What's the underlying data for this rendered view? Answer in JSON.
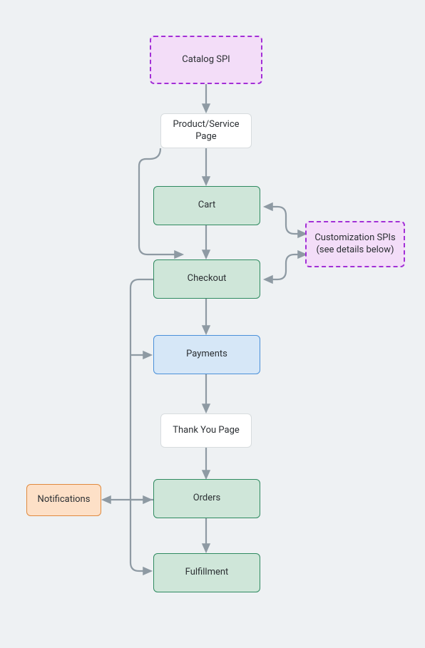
{
  "nodes": {
    "catalog_spi": {
      "label": "Catalog SPI"
    },
    "product_page": {
      "label": "Product/Service Page"
    },
    "cart": {
      "label": "Cart"
    },
    "customization_spis": {
      "label": "Customization SPIs (see details below)"
    },
    "checkout": {
      "label": "Checkout"
    },
    "payments": {
      "label": "Payments"
    },
    "thank_you": {
      "label": "Thank You Page"
    },
    "orders": {
      "label": "Orders"
    },
    "notifications": {
      "label": "Notifications"
    },
    "fulfillment": {
      "label": "Fulfillment"
    }
  },
  "edges": [
    {
      "from": "catalog_spi",
      "to": "product_page",
      "bidirectional": false
    },
    {
      "from": "product_page",
      "to": "cart",
      "bidirectional": false
    },
    {
      "from": "product_page",
      "to": "checkout",
      "bidirectional": false,
      "routing": "left-bypass"
    },
    {
      "from": "cart",
      "to": "checkout",
      "bidirectional": false
    },
    {
      "from": "customization_spis",
      "to": "cart",
      "bidirectional": true
    },
    {
      "from": "customization_spis",
      "to": "checkout",
      "bidirectional": true
    },
    {
      "from": "checkout",
      "to": "payments",
      "bidirectional": false
    },
    {
      "from": "payments",
      "to": "thank_you",
      "bidirectional": false
    },
    {
      "from": "thank_you",
      "to": "orders",
      "bidirectional": false
    },
    {
      "from": "orders",
      "to": "fulfillment",
      "bidirectional": false
    },
    {
      "from": "orders",
      "to": "notifications",
      "bidirectional": false
    },
    {
      "from": "checkout",
      "to": "orders",
      "bidirectional": false,
      "routing": "left-branch"
    },
    {
      "from": "checkout",
      "to": "fulfillment",
      "bidirectional": false,
      "routing": "left-branch"
    }
  ],
  "colors": {
    "arrow": "#8e9aa3",
    "purple_border": "#a22fd6",
    "green_border": "#2f8a60",
    "blue_border": "#4a90d9",
    "orange_border": "#e08a3e"
  }
}
